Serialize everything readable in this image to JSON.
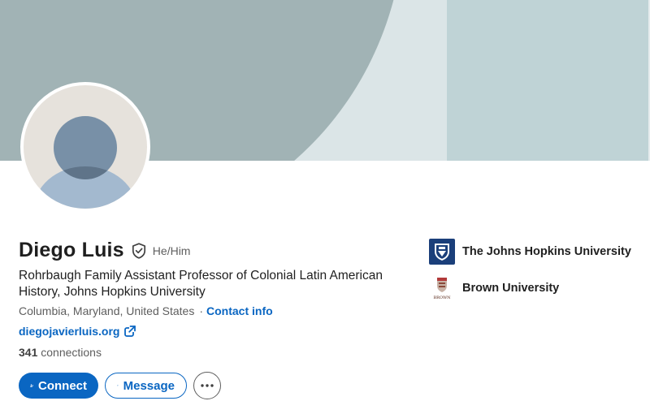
{
  "profile": {
    "name": "Diego Luis",
    "pronouns": "He/Him",
    "headline": "Rohrbaugh Family Assistant Professor of Colonial Latin American History, Johns Hopkins University",
    "location": "Columbia, Maryland, United States",
    "location_separator": "·",
    "contact_label": "Contact info",
    "website": "diegojavierluis.org",
    "connections_count": "341",
    "connections_label": "connections"
  },
  "actions": {
    "connect_label": "Connect",
    "message_label": "Message",
    "more_icon": "ellipsis-icon"
  },
  "organizations": [
    {
      "name": "The Johns Hopkins University",
      "logo": "jhu-shield-logo"
    },
    {
      "name": "Brown University",
      "logo": "brown-shield-logo",
      "logo_text": "BROWN"
    }
  ],
  "colors": {
    "accent": "#0a66c2",
    "banner_arc": "#a1b3b5",
    "banner_light": "#dbe5e7",
    "banner_right": "#bfd3d6"
  }
}
